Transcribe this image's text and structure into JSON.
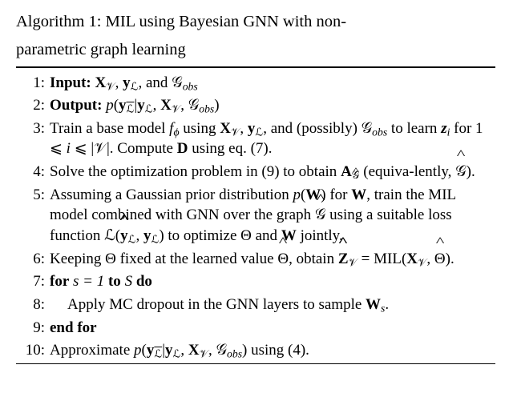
{
  "algorithm": {
    "label": "Algorithm 1:",
    "title_part1": "MIL using Bayesian GNN with non-",
    "title_part2": "parametric graph learning"
  },
  "steps": {
    "n1": "1:",
    "n2": "2:",
    "n3": "3:",
    "n4": "4:",
    "n5": "5:",
    "n6": "6:",
    "n7": "7:",
    "n8": "8:",
    "n9": "9:",
    "n10": "10:"
  },
  "kw": {
    "input": "Input:",
    "output": "Output:",
    "for": "for",
    "do": "do",
    "to": "to",
    "endfor": "end for"
  },
  "sym": {
    "XV": "X",
    "V": "𝒱",
    "yL": "y",
    "L": "ℒ",
    "Lbar": "ℒ",
    "G": "𝒢",
    "obs": "obs",
    "and": "and",
    "comma": ", ",
    "p": "p",
    "pipe": "|",
    "Train_base": "Train a base model ",
    "fphi": "f",
    "phi": "ϕ",
    "using": " using ",
    "poss": "(possibly)",
    "to_learn": " to learn ",
    "z": "z",
    "i": "i",
    "for_range": " for 1 ⩽ ",
    "le_V": " ⩽ |𝒱|. Compute ",
    "D": "D",
    "eq7": " using eq. (7).",
    "Solve": "Solve the optimization problem in (9) to obtain ",
    "A": "A",
    "Ghat": "𝒢",
    "equiv": " (equiva-lently, ",
    "close": ").",
    "AssumeG": "Assuming a Gaussian prior distribution ",
    "pW": "p",
    "W": "W",
    "forW": " for ",
    "train": ", train the MIL model combined with GNN over the graph ",
    "suitable": " using a suitable loss function ",
    "Lfn": "ℒ",
    "optimize": " to optimize Θ and ",
    "jointly": " jointly.",
    "Keep": "Keeping Θ fixed at the learned value ",
    "Theta": "Θ",
    "obtainZ": ", obtain ",
    "Z": "Z",
    "eqMIL1": "MIL",
    "eqMIL2": "(",
    "Thetahat": "Θ",
    "eqMIL3": ").",
    "eq": " = ",
    "loop": "s = 1",
    "S": "S",
    "apply": "Apply MC dropout in the GNN layers to sample ",
    "Ws": "W",
    "s": "s",
    "period": ".",
    "approx": "Approximate ",
    "using4": " using (4)."
  }
}
